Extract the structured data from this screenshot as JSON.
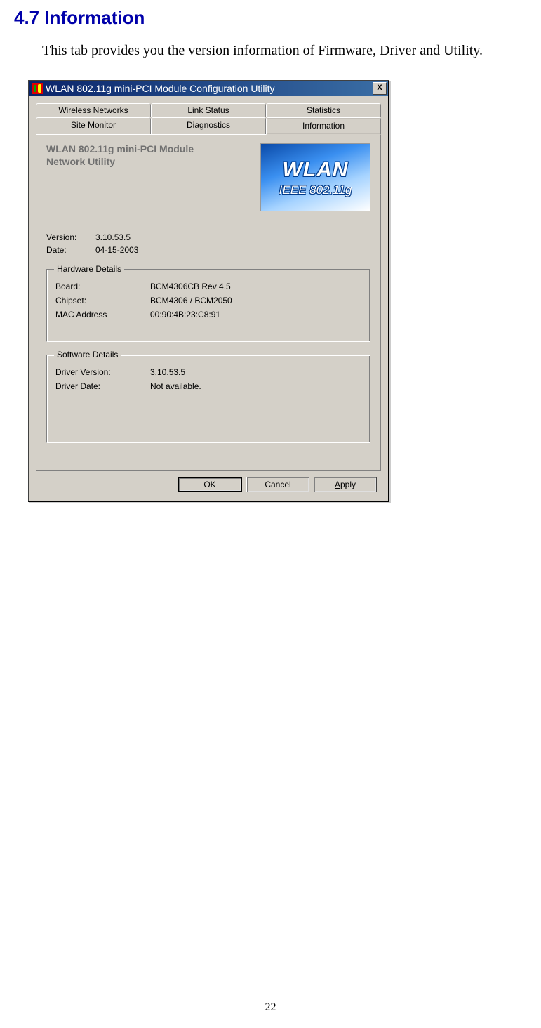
{
  "doc": {
    "heading": "4.7 Information",
    "paragraph": "This tab provides you the version information of Firmware, Driver and Utility.",
    "page_number": "22"
  },
  "dialog": {
    "title": "WLAN 802.11g mini-PCI Module Configuration Utility",
    "close_glyph": "X",
    "tabs_row1": {
      "wireless_networks": "Wireless Networks",
      "link_status": "Link Status",
      "statistics": "Statistics"
    },
    "tabs_row2": {
      "site_monitor": "Site Monitor",
      "diagnostics": "Diagnostics",
      "information": "Information"
    },
    "info_panel": {
      "product_line1": "WLAN 802.11g mini-PCI Module",
      "product_line2": "Network Utility",
      "logo_wlan": "WLAN",
      "logo_ieee": "IEEE 802.11g",
      "version_label": "Version:",
      "version_value": "3.10.53.5",
      "date_label": "Date:",
      "date_value": "04-15-2003"
    },
    "hardware": {
      "title": "Hardware Details",
      "board_label": "Board:",
      "board_value": "BCM4306CB   Rev 4.5",
      "chipset_label": "Chipset:",
      "chipset_value": "BCM4306 / BCM2050",
      "mac_label": "MAC Address",
      "mac_value": "00:90:4B:23:C8:91"
    },
    "software": {
      "title": "Software Details",
      "driver_version_label": "Driver Version:",
      "driver_version_value": "3.10.53.5",
      "driver_date_label": "Driver Date:",
      "driver_date_value": "Not available."
    },
    "buttons": {
      "ok": "OK",
      "cancel": "Cancel",
      "apply_prefix": "A",
      "apply_rest": "pply"
    }
  }
}
